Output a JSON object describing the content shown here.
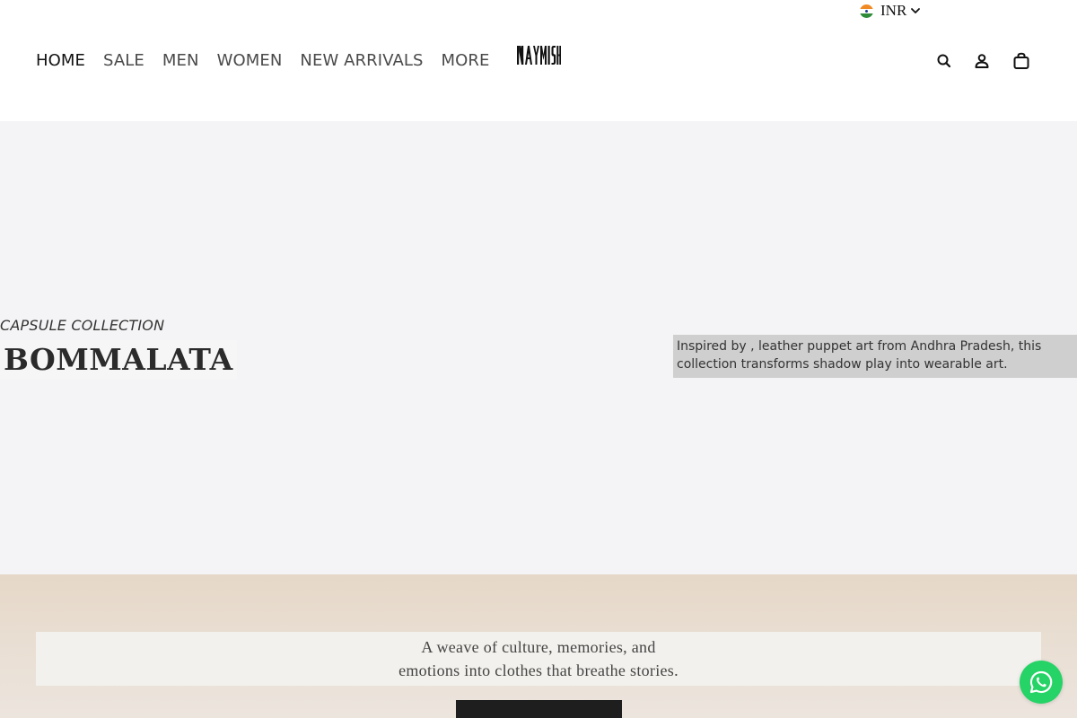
{
  "header": {
    "nav": [
      {
        "label": "HOME",
        "active": true
      },
      {
        "label": "SALE"
      },
      {
        "label": "MEN"
      },
      {
        "label": "WOMEN"
      },
      {
        "label": "NEW ARRIVALS"
      },
      {
        "label": "MORE"
      }
    ],
    "logo_text": "NAYMISH",
    "currency": {
      "code": "INR",
      "flag": "india-flag-icon"
    },
    "icons": [
      "search-icon",
      "account-icon",
      "cart-icon"
    ]
  },
  "hero": {
    "eyebrow": "CAPSULE COLLECTION",
    "title": "BOMMALATA",
    "description": "Inspired by , leather puppet art from Andhra Pradesh, this collection transforms shadow play into wearable art."
  },
  "story": {
    "line1": "A weave of culture, memories, and",
    "line2": "emotions into clothes that breathe stories."
  },
  "floating": {
    "icon": "whatsapp-icon",
    "color": "#25d366"
  },
  "colors": {
    "hero_bg": "#f4f4f6",
    "story_bg": "#e6d8c8",
    "button_bg": "#1e1e1e"
  }
}
